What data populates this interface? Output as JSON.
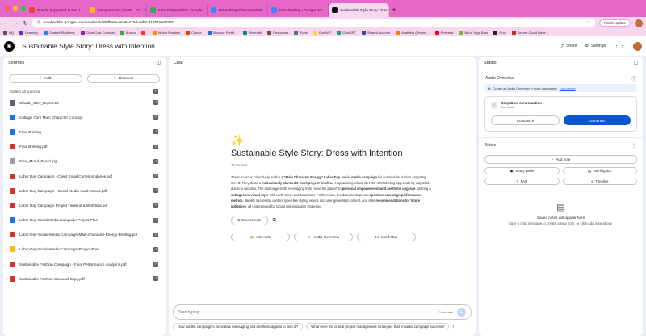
{
  "browser": {
    "tabs": [
      {
        "title": "Brands Supported In the U...",
        "color": "#ea4335"
      },
      {
        "title": "Instagram Art - TASE... Gr...",
        "color": "#fbbc04"
      },
      {
        "title": "Final Deliverables - Google ...",
        "color": "#34a853"
      },
      {
        "title": "Wave Project Documentati...",
        "color": "#4285f4"
      },
      {
        "title": "Final Briefing - Google Doc...",
        "color": "#4285f4"
      },
      {
        "title": "Sustainable Style Story: Dres...",
        "color": "#111111",
        "active": true
      }
    ],
    "new_tab": "+",
    "url": "notebooklm.google.com/notebook/8f9fbe5a-0ce8-475d-a8b7-d12015e87250",
    "finish_update": "Finish update",
    "bookmarks": [
      {
        "label": "HQ",
        "color": "#555555"
      },
      {
        "label": "Learning",
        "color": "#5e35b1"
      },
      {
        "label": "Content Platforms",
        "color": "#1e88e5"
      },
      {
        "label": "Clear Cost Contrast",
        "color": "#8e24aa"
      },
      {
        "label": "Aurora",
        "color": "#43a047"
      },
      {
        "label": "",
        "color": "#e53935"
      },
      {
        "label": "Vector Fondant",
        "color": "#fb8c00"
      },
      {
        "label": "Claude",
        "color": "#d84315"
      },
      {
        "label": "Shortcut Portfo...",
        "color": "#1976d2"
      },
      {
        "label": "Silverwiki",
        "color": "#00897b"
      },
      {
        "label": "Resources",
        "color": "#6d4c41"
      },
      {
        "label": "Tools",
        "color": "#546e7a"
      },
      {
        "label": "CoinWIT",
        "color": "#fdd835"
      },
      {
        "label": "ChatGPT",
        "color": "#10a37f"
      },
      {
        "label": "Shared Account",
        "color": "#3949ab"
      },
      {
        "label": "Analytics (Revers...",
        "color": "#f57c00"
      },
      {
        "label": "Pinterest",
        "color": "#e60023"
      },
      {
        "label": "Boho Yoga Bars",
        "color": "#7cb342"
      },
      {
        "label": "Grok",
        "color": "#222222"
      },
      {
        "label": "Secure Cloud Rese...",
        "color": "#c62828"
      }
    ]
  },
  "header": {
    "title": "Sustainable Style Story: Dress with Intention",
    "share": "Share",
    "settings": "Settings"
  },
  "sources": {
    "title": "Sources",
    "add": "Add",
    "discover": "Discover",
    "select_all": "Select all sources",
    "items": [
      {
        "name": "Claude_CSV_Export.txt",
        "color": "#5f6368"
      },
      {
        "name": "Cottage Core Main Character Concept",
        "color": "#1a73e8"
      },
      {
        "name": "Final Briefing",
        "color": "#1a73e8"
      },
      {
        "name": "Final Briefing.pdf",
        "color": "#d93025"
      },
      {
        "name": "Final_Mood_Board.jpg",
        "color": "#9aa0a6"
      },
      {
        "name": "Labor Day Campaign - Client Email Correspondence.pdf",
        "color": "#d93025"
      },
      {
        "name": "Labor Day Campaign - Social Media Audit Report.pdf",
        "color": "#d93025"
      },
      {
        "name": "Labor Day Campaign Project Timeline & Workflow.pdf",
        "color": "#d93025"
      },
      {
        "name": "Labor Day Social Media Campaign Project Plan",
        "color": "#1a73e8"
      },
      {
        "name": "Labor-Day-Social-Media-Campaign-Main-Character-Energy-Briefing.pdf",
        "color": "#d93025"
      },
      {
        "name": "Labor-Day-Social-Media-Campaign-Project-Plan",
        "color": "#fbbc04"
      },
      {
        "name": "Sustainable Fashion Campaign - Final Performance Analytics.pdf",
        "color": "#d93025"
      },
      {
        "name": "Sustainable Fashion Carousel Copy.pdf",
        "color": "#d93025"
      }
    ]
  },
  "chat": {
    "title": "Chat",
    "notebook_title": "Sustainable Style Story: Dress with Intention",
    "source_count": "13 sources",
    "summary": [
      {
        "t": "These sources collectively outline a ",
        "b": false
      },
      {
        "t": "\"Main Character Energy\" Labor Day social media campaign",
        "b": true
      },
      {
        "t": " for sustainable fashion, targeting Gen Z. They detail a ",
        "b": false
      },
      {
        "t": "meticulously planned 6-week project timeline",
        "b": true
      },
      {
        "t": ", emphasizing critical Director of Marketing approvals by July 23rd due to a vacation. The campaign shifts messaging from \"save the planet\" to ",
        "b": false
      },
      {
        "t": "personal empowerment and aesthetic upgrade",
        "b": true
      },
      {
        "t": ", utilizing a ",
        "b": false
      },
      {
        "t": "cottagecore visual style",
        "b": true
      },
      {
        "t": " with earth tones and botanicals. Furthermore, the documents present ",
        "b": false
      },
      {
        "t": "positive campaign performance metrics",
        "b": true
      },
      {
        "t": ", identify successful content types like styling videos and user-generated content, and offer ",
        "b": false
      },
      {
        "t": "recommendations for future initiatives",
        "b": true
      },
      {
        "t": ", all underpinned by robust risk mitigation strategies.",
        "b": false
      }
    ],
    "save_to_note": "Save to note",
    "actions": {
      "add_note": "Add note",
      "audio_overview": "Audio Overview",
      "mind_map": "Mind Map"
    },
    "input_placeholder": "Start typing...",
    "input_count": "13 sources",
    "suggestions": [
      "How did the campaign's innovative messaging and aesthetic appeal to Gen Z?",
      "What were the critical project management strategies that ensured campaign success?"
    ]
  },
  "studio": {
    "title": "Studio",
    "audio_overview": "Audio Overview",
    "banner_text": "Create an Audio Overview in more languages!",
    "learn_more": "Learn more",
    "deep_dive": "Deep Dive conversation",
    "two_hosts": "Two hosts",
    "customize": "Customize",
    "generate": "Generate",
    "notes": "Notes",
    "add_note": "Add note",
    "tools": [
      "Study guide",
      "Briefing doc",
      "FAQ",
      "Timeline"
    ],
    "empty_title": "Saved notes will appear here",
    "empty_sub": "Save a chat message to create a new note, or click Add note above."
  },
  "colors": {
    "accent": "#0b57d0",
    "tabbar": "#e767c9",
    "toolbar": "#f7d6ef"
  }
}
